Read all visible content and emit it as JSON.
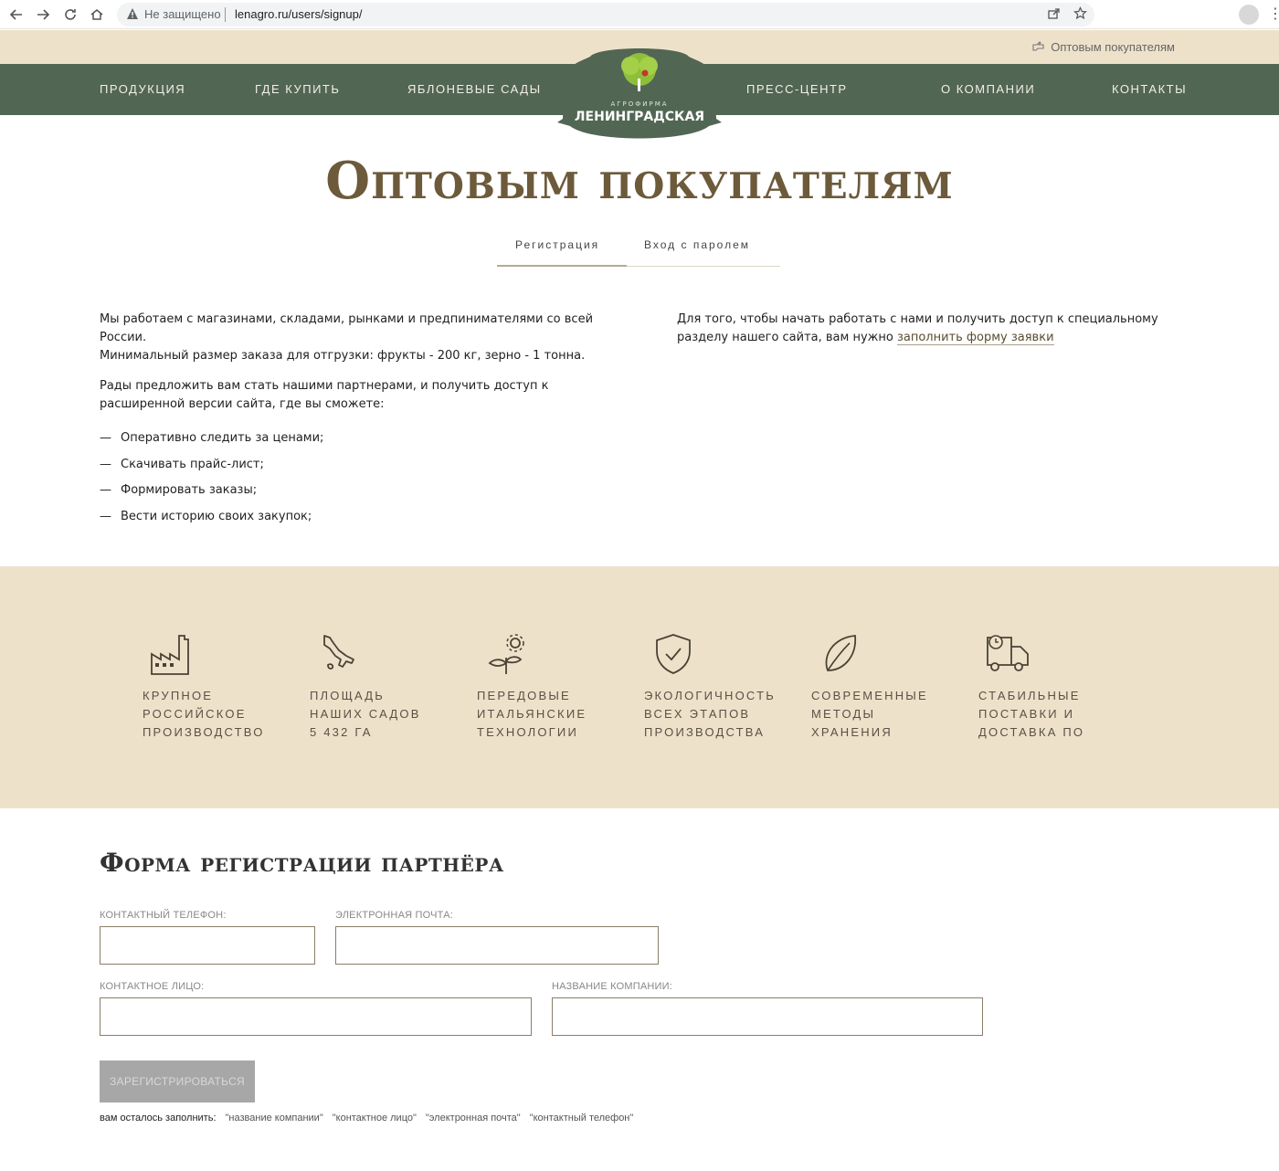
{
  "browser": {
    "insecure_label": "Не защищено",
    "url": "lenagro.ru/users/signup/"
  },
  "top": {
    "wholesale_link": "Оптовым покупателям"
  },
  "nav": {
    "items": [
      "Продукция",
      "Где купить",
      "Яблоневые сады",
      "Пресс-центр",
      "О компании",
      "Контакты"
    ],
    "logo_top": "АГРОФИРМА",
    "logo_name": "ЛЕНИНГРАДСКАЯ"
  },
  "page": {
    "title": "Оптовым покупателям",
    "tabs": [
      "Регистрация",
      "Вход с паролем"
    ]
  },
  "intro": {
    "p1_line1": "Мы работаем с магазинами, складами, рынками и предпинимателями со всей России.",
    "p1_line2": "Минимальный размер заказа для отгрузки: фрукты - 200 кг, зерно - 1 тонна.",
    "p2": "Рады предложить вам стать нашими партнерами, и получить доступ к расширенной версии сайта, где вы сможете:",
    "bullets": [
      "Оперативно следить за ценами;",
      "Скачивать прайс-лист;",
      "Формировать заказы;",
      "Вести историю своих закупок;"
    ],
    "right_text": "Для того, чтобы начать работать с нами и получить доступ к специальному разделу нашего сайта, вам нужно ",
    "right_link": "заполнить форму заявки"
  },
  "features": [
    {
      "icon": "factory-icon",
      "label": "Крупное\nроссийское\nпроизводство"
    },
    {
      "icon": "italy-map-icon",
      "label": "Площадь\nнаших садов\n5 432 га"
    },
    {
      "icon": "sprout-gear-icon",
      "label": "Передовые\nитальянские\nтехнологии"
    },
    {
      "icon": "shield-check-icon",
      "label": "Экологичность\nвсех этапов\nпроизводства"
    },
    {
      "icon": "leaf-icon",
      "label": "Современные\nметоды\nхранения"
    },
    {
      "icon": "delivery-truck-icon",
      "label": "Стабильные\nпоставки и\nдоставка по"
    }
  ],
  "form": {
    "title": "Форма регистрации партнёра",
    "phone_label": "Контактный телефон:",
    "email_label": "Электронная почта:",
    "contact_label": "Контактное лицо:",
    "company_label": "Название компании:",
    "submit": "Зарегистрироваться",
    "remaining_label": "вам осталось заполнить:",
    "remaining": [
      "\"название компании\"",
      "\"контактное лицо\"",
      "\"электронная почта\"",
      "\"контактный телефон\""
    ]
  },
  "colors": {
    "nav_green": "#526654",
    "beige": "#ede2c9",
    "title_brown": "#6c5a3b"
  }
}
